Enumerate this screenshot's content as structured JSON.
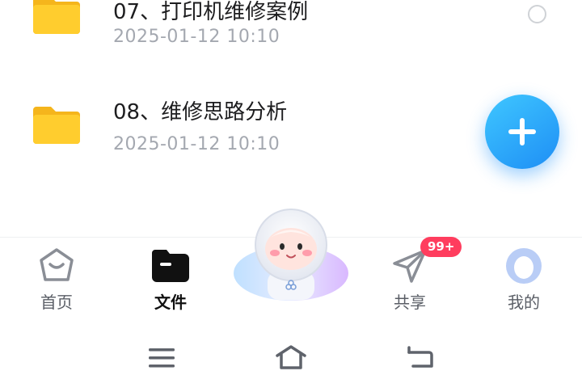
{
  "files": [
    {
      "name": "07、打印机维修案例",
      "date": "2025-01-12  10:10"
    },
    {
      "name": "08、维修思路分析",
      "date": "2025-01-12  10:10"
    }
  ],
  "tabs": [
    {
      "label": "首页",
      "icon": "home-icon"
    },
    {
      "label": "文件",
      "icon": "folder-icon",
      "active": true
    },
    {
      "label": "共享",
      "icon": "send-icon"
    },
    {
      "label": "我的",
      "icon": "avatar"
    }
  ],
  "share_badge": "99+",
  "colors": {
    "accent": "#1e8ef5",
    "folder": "#ffc928",
    "badge": "#ff3d5e",
    "date_text": "#a4a8b0"
  }
}
